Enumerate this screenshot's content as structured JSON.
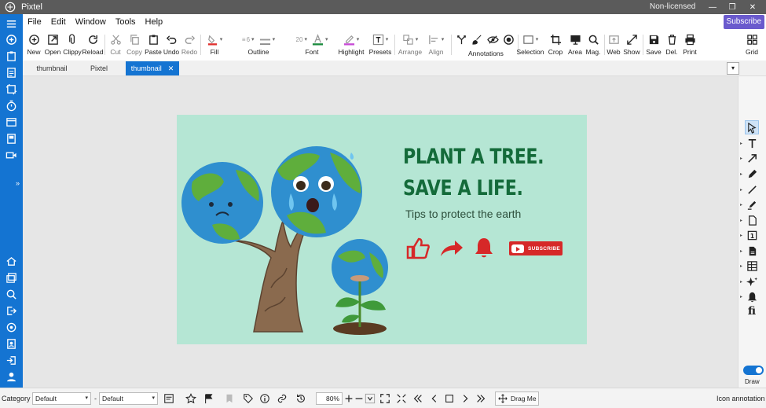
{
  "window": {
    "app_title": "Pixtel",
    "license_status": "Non-licensed",
    "minimize_glyph": "—",
    "restore_glyph": "❐",
    "close_glyph": "✕"
  },
  "menu": {
    "items": [
      "File",
      "Edit",
      "Window",
      "Tools",
      "Help"
    ],
    "subscribe_label": "Subscribe"
  },
  "toolbar": {
    "new": "New",
    "open": "Open",
    "clippy": "Clippy",
    "reload": "Reload",
    "cut": "Cut",
    "copy": "Copy",
    "paste": "Paste",
    "undo": "Undo",
    "redo": "Redo",
    "fill": "Fill",
    "outline": "Outline",
    "outline_width": "6",
    "font": "Font",
    "font_size": "20",
    "highlight": "Highlight",
    "presets": "Presets",
    "arrange": "Arrange",
    "align": "Align",
    "annotations": "Annotations",
    "selection": "Selection",
    "crop": "Crop",
    "area": "Area",
    "mag": "Mag.",
    "web": "Web",
    "show": "Show",
    "save": "Save",
    "del": "Del.",
    "print": "Print",
    "grid": "Grid",
    "fill_color": "#e0312f",
    "outline_color": "#8a8a8a",
    "font_color": "#1b8a3e",
    "highlight_color": "#c84bd6"
  },
  "tabs": {
    "items": [
      {
        "label": "thumbnail",
        "active": false
      },
      {
        "label": "Pixtel",
        "active": false
      },
      {
        "label": "thumbnail",
        "active": true
      }
    ],
    "close_glyph": "✕",
    "menu_glyph": "▾"
  },
  "thumbnail_content": {
    "headline_1": "PLANT A TREE.",
    "headline_2": "SAVE A LIFE.",
    "tagline": "Tips to protect the earth",
    "subscribe_button": "SUBSCRIBE",
    "accent_color": "#d62828",
    "background_color": "#b5e6d4"
  },
  "right_tools": {
    "draw_label": "Draw",
    "draw_toggle_on": true,
    "items": [
      "pointer-icon",
      "text-icon",
      "arrow-icon",
      "pen-icon",
      "line-icon",
      "marker-icon",
      "document-icon",
      "step-number-icon",
      "doc-fill-icon",
      "table-icon",
      "sparkle-icon",
      "bell-icon",
      "fi-ligature-icon"
    ],
    "step_glyph": "1",
    "fi_glyph": "fi"
  },
  "statusbar": {
    "category_label": "Category",
    "category_value": "Default",
    "separator": "-",
    "preset_value": "Default",
    "zoom_value": "80%",
    "drag_me_label": "Drag Me",
    "mode_label": "Icon annotation"
  }
}
